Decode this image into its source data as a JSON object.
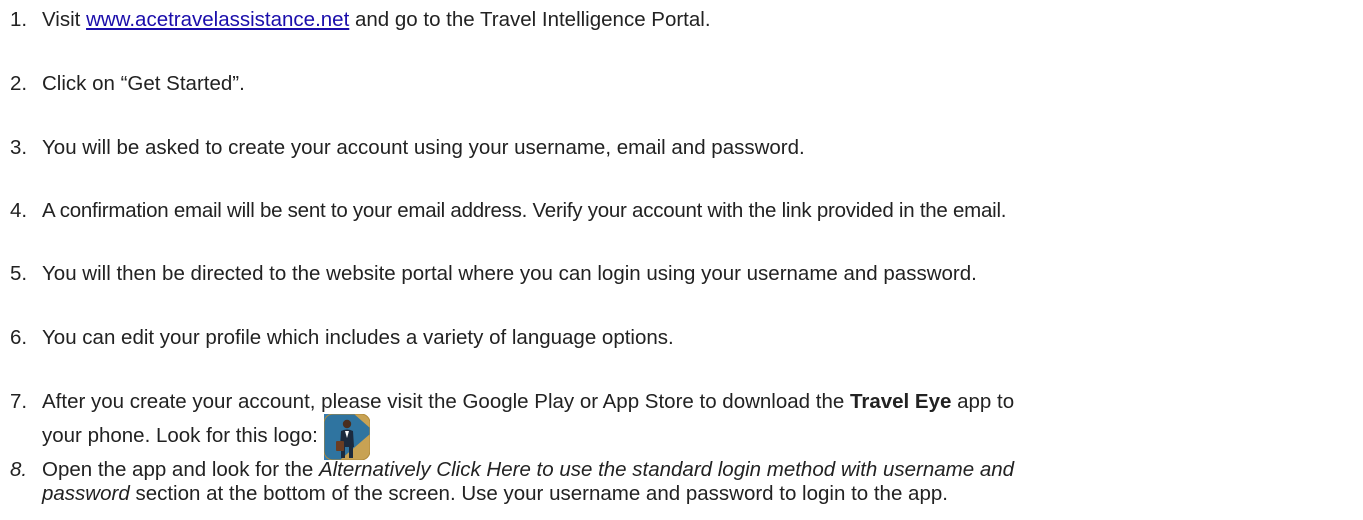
{
  "steps": [
    {
      "number": "1.",
      "before_link": "Visit ",
      "link": "www.acetravelassistance.net",
      "after_link": " and go to the Travel Intelligence Portal."
    },
    {
      "number": "2.",
      "text": "Click on “Get Started”."
    },
    {
      "number": "3.",
      "text": "You will be asked to create your account using your username, email and password."
    },
    {
      "number": "4.",
      "text": "A confirmation email will be sent to your email address. Verify your account with the link provided in the email."
    },
    {
      "number": "5.",
      "text": "You will then be directed to the website portal where you can login using your username and password."
    },
    {
      "number": "6.",
      "text": "You can edit your profile which includes a variety of language options."
    },
    {
      "number": "7.",
      "before_bold": "After you create your account, please visit the Google Play or App Store to download the ",
      "bold": "Travel Eye",
      "after_bold": " app to",
      "line2": "your phone. Look for this logo:",
      "logo_icon": "travel-eye-app-logo"
    },
    {
      "number": "8.",
      "before_italic": "Open the app and look for the ",
      "italic_1": "Alternatively Click Here to use the standard login method with username and",
      "italic_2": "password",
      "after_italic": " section at the bottom of the screen. Use your username and password to login to the app."
    }
  ],
  "colors": {
    "text": "#222222",
    "link": "#1a0dab",
    "logo_background": "#c8a253",
    "logo_accent": "#1e6fa8"
  }
}
